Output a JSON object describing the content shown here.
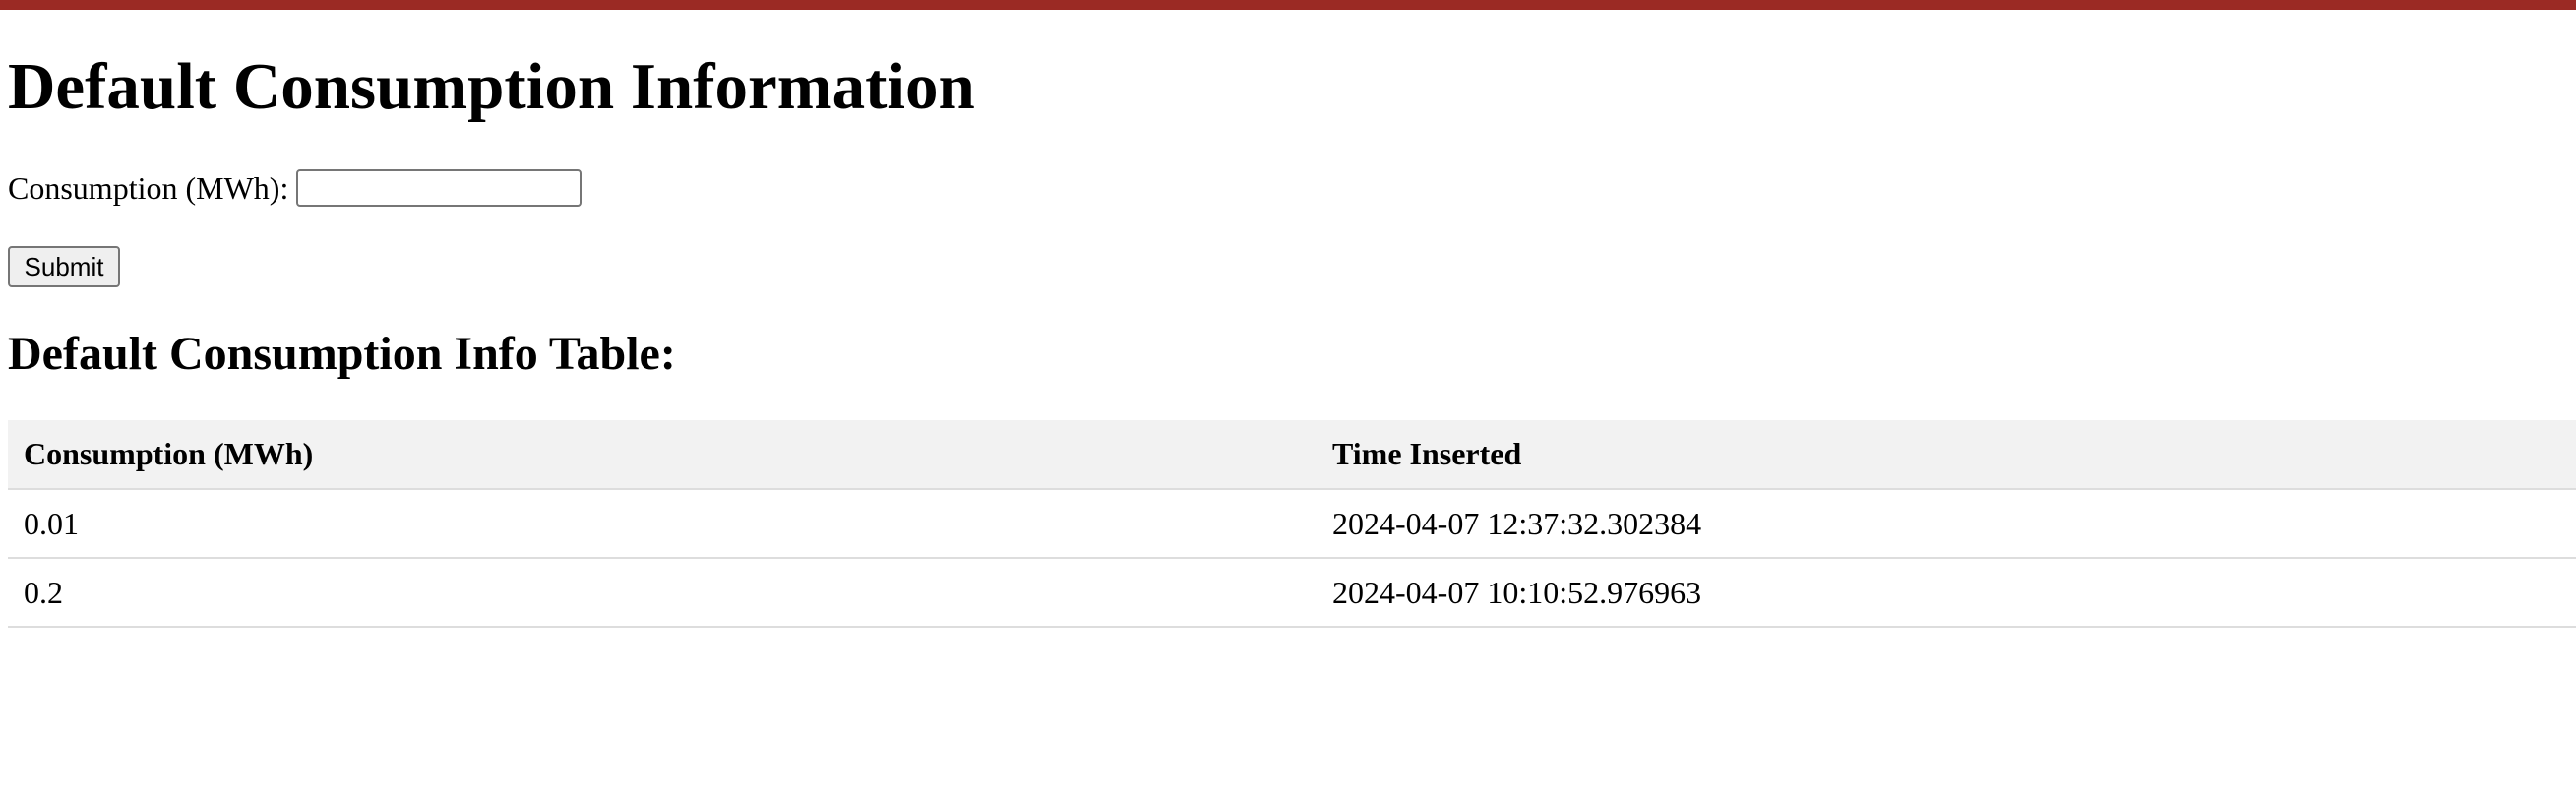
{
  "page": {
    "accent_color": "#9b2a24",
    "title": "Default Consumption Information"
  },
  "form": {
    "consumption_label": "Consumption (MWh):",
    "consumption_value": "",
    "submit_label": "Submit"
  },
  "table": {
    "heading": "Default Consumption Info Table:",
    "columns": [
      "Consumption (MWh)",
      "Time Inserted"
    ],
    "rows": [
      [
        "0.01",
        "2024-04-07 12:37:32.302384"
      ],
      [
        "0.2",
        "2024-04-07 10:10:52.976963"
      ]
    ]
  }
}
